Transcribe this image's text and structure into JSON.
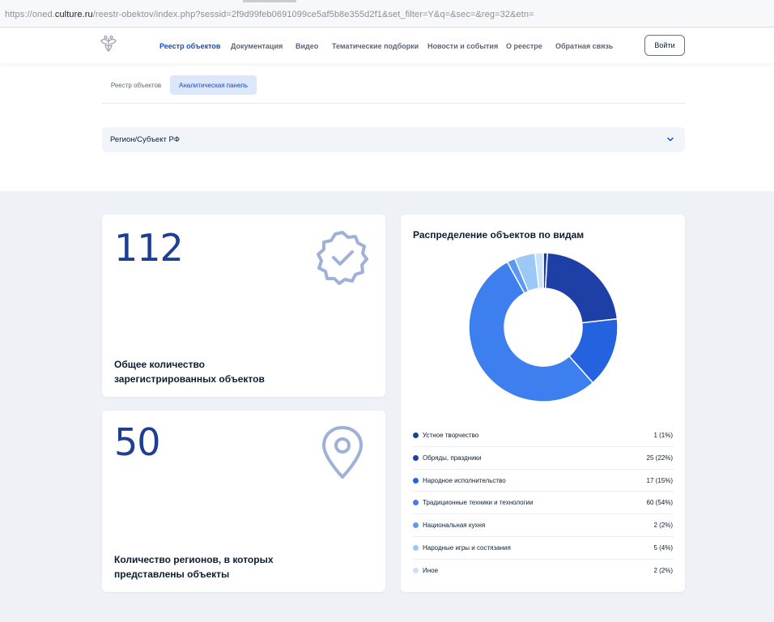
{
  "browser": {
    "url_prefix": "https://oned.",
    "url_host": "culture.ru",
    "url_rest": "/reestr-obektov/index.php?sessid=2f9d99feb0691099ce5af5b8e355d2f1&set_filter=Y&q=&sec=&reg=32&etn="
  },
  "header": {
    "logo_icon": "coat-of-arms-icon",
    "nav": [
      {
        "label": "Реестр объектов",
        "active": true
      },
      {
        "label": "Документация",
        "active": false
      },
      {
        "label": "Видео",
        "active": false
      },
      {
        "label": "Тематические подборки",
        "active": false
      },
      {
        "label": "Новости и события",
        "active": false
      },
      {
        "label": "О реестре",
        "active": false
      },
      {
        "label": "Обратная связь",
        "active": false
      }
    ],
    "login_label": "Войти"
  },
  "subtabs": [
    {
      "label": "Реестр объектов",
      "active": false
    },
    {
      "label": "Аналитическая панель",
      "active": true
    }
  ],
  "region_select": {
    "label": "Регион/Субъект РФ",
    "icon": "chevron-down-icon"
  },
  "stats": {
    "total": {
      "value": "112",
      "caption": "Общее количество зарегистрированных объектов",
      "icon": "verified-badge-icon"
    },
    "regions": {
      "value": "50",
      "caption": "Количество регионов, в которых представлены объекты",
      "icon": "map-pin-icon"
    }
  },
  "chart_data": {
    "type": "pie",
    "title": "Распределение объектов по видам",
    "series": [
      {
        "name": "Устное творчество",
        "value": 1,
        "display": "1 (1%)",
        "color": "#1e3f91"
      },
      {
        "name": "Обряды, праздники",
        "value": 25,
        "display": "25 (22%)",
        "color": "#1d3fa6"
      },
      {
        "name": "Народное исполнительство",
        "value": 17,
        "display": "17 (15%)",
        "color": "#2462e0"
      },
      {
        "name": "Традиционные техники и технологии",
        "value": 60,
        "display": "60 (54%)",
        "color": "#3d7fef"
      },
      {
        "name": "Национальная кухня",
        "value": 2,
        "display": "2 (2%)",
        "color": "#5b9af0"
      },
      {
        "name": "Народные игры и состязания",
        "value": 5,
        "display": "5 (4%)",
        "color": "#9cc8f7"
      },
      {
        "name": "Иное",
        "value": 2,
        "display": "2 (2%)",
        "color": "#c9e1f9"
      }
    ]
  }
}
